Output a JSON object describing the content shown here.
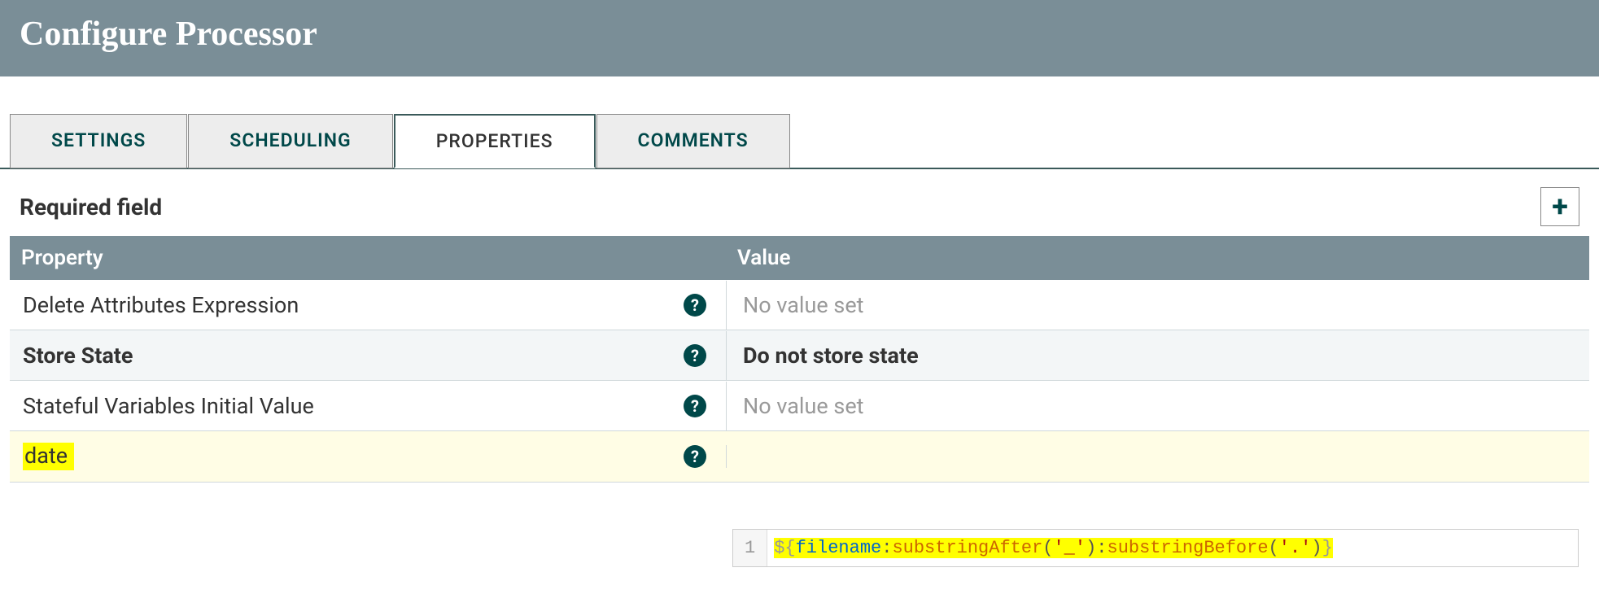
{
  "dialog": {
    "title": "Configure Processor"
  },
  "tabs": [
    {
      "label": "SETTINGS",
      "active": false
    },
    {
      "label": "SCHEDULING",
      "active": false
    },
    {
      "label": "PROPERTIES",
      "active": true
    },
    {
      "label": "COMMENTS",
      "active": false
    }
  ],
  "required_field_label": "Required field",
  "add_icon": "+",
  "table_headers": {
    "property": "Property",
    "value": "Value"
  },
  "help_glyph": "?",
  "properties": [
    {
      "name": "Delete Attributes Expression",
      "value": "No value set",
      "bold": false,
      "placeholder": true,
      "highlighted": false,
      "alt": false
    },
    {
      "name": "Store State",
      "value": "Do not store state",
      "bold": true,
      "placeholder": false,
      "highlighted": false,
      "alt": true
    },
    {
      "name": "Stateful Variables Initial Value",
      "value": "No value set",
      "bold": false,
      "placeholder": true,
      "highlighted": false,
      "alt": false
    },
    {
      "name": "date",
      "value": "",
      "bold": false,
      "placeholder": false,
      "highlighted": true,
      "alt": true
    }
  ],
  "editor": {
    "line_number": "1",
    "expression": "${filename:substringAfter('_'):substringBefore('.')}",
    "tokens": {
      "dollar": "$",
      "lbrace": "{",
      "rbrace": "}",
      "var": "filename",
      "colon1": ":",
      "func1": "substringAfter",
      "lparen1": "(",
      "str1": "'_'",
      "rparen1": ")",
      "colon2": ":",
      "func2": "substringBefore",
      "lparen2": "(",
      "str2": "'.'",
      "rparen2": ")"
    }
  }
}
